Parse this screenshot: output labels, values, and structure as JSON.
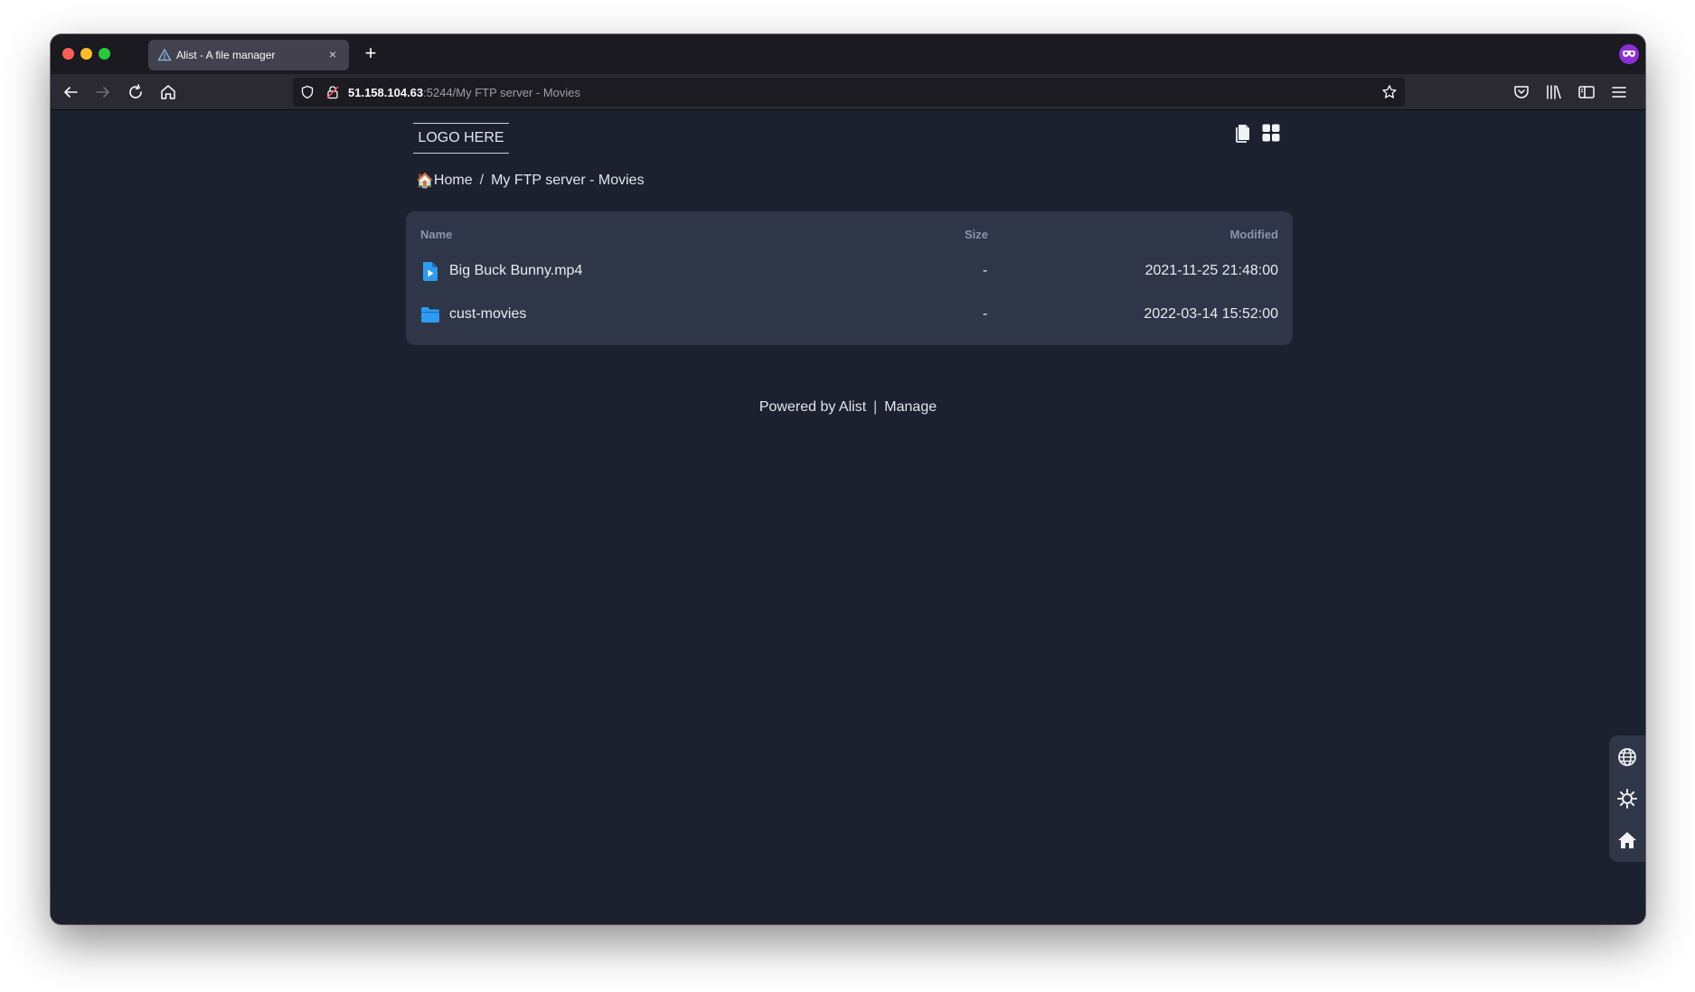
{
  "browser": {
    "tab_title": "Alist - A file manager",
    "tab_close": "×",
    "new_tab": "+",
    "url_host": "51.158.104.63",
    "url_rest": ":5244/My FTP server - Movies"
  },
  "page": {
    "logo_text": "LOGO HERE",
    "breadcrumb": {
      "home_emoji": "🏠",
      "home": "Home",
      "separator": "/",
      "current": "My FTP server - Movies"
    },
    "table": {
      "headers": {
        "name": "Name",
        "size": "Size",
        "modified": "Modified"
      },
      "rows": [
        {
          "icon": "video-file-icon",
          "name": "Big Buck Bunny.mp4",
          "size": "-",
          "modified": "2021-11-25 21:48:00"
        },
        {
          "icon": "folder-icon",
          "name": "cust-movies",
          "size": "-",
          "modified": "2022-03-14 15:52:00"
        }
      ]
    },
    "footer": {
      "powered": "Powered by Alist",
      "separator": "|",
      "manage": "Manage"
    }
  },
  "colors": {
    "page_bg": "#1c2130",
    "card_bg": "#2e3648",
    "accent_blue": "#2f9bf0"
  }
}
